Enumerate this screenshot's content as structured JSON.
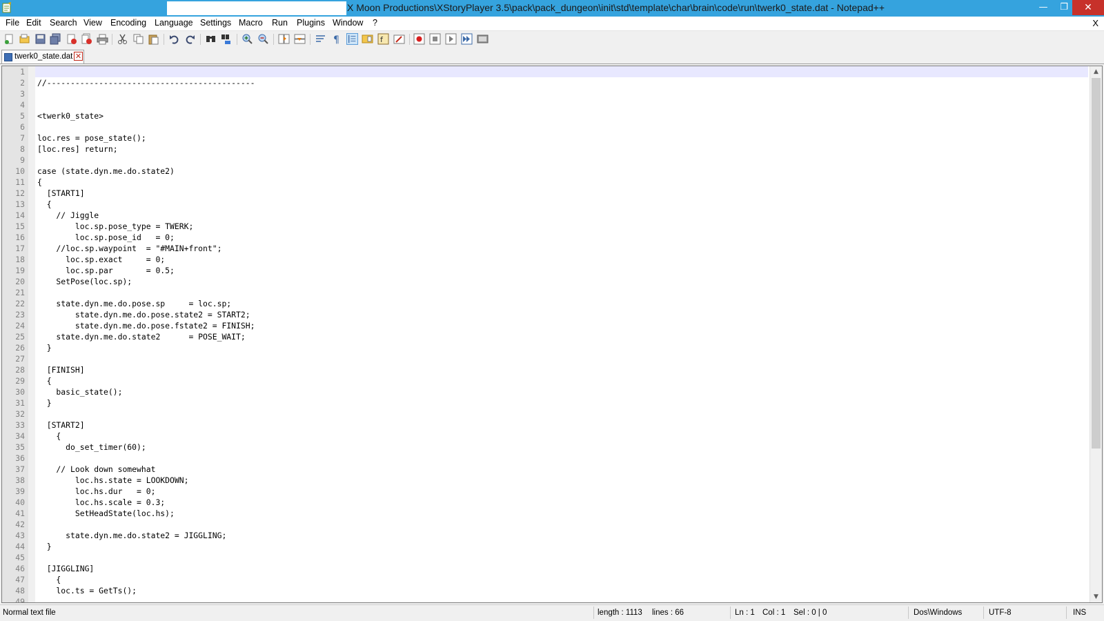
{
  "window": {
    "title": "X Moon Productions\\XStoryPlayer 3.5\\pack\\pack_dungeon\\init\\std\\template\\char\\brain\\code\\run\\twerk0_state.dat - Notepad++",
    "minimize_label": "—",
    "maximize_label": "❐",
    "close_label": "✕",
    "app_icon": "notepad-icon"
  },
  "menu": {
    "items": [
      "File",
      "Edit",
      "Search",
      "View",
      "Encoding",
      "Language",
      "Settings",
      "Macro",
      "Run",
      "Plugins",
      "Window",
      "?"
    ],
    "close_label": "X"
  },
  "toolbar": {
    "icons": [
      "new-file-icon",
      "open-file-icon",
      "save-icon",
      "save-all-icon",
      "close-icon",
      "close-all-icon",
      "print-icon",
      "cut-icon",
      "copy-icon",
      "paste-icon",
      "undo-icon",
      "redo-icon",
      "find-icon",
      "replace-icon",
      "zoom-in-icon",
      "zoom-out-icon",
      "sync-vertical-icon",
      "sync-horizontal-icon",
      "word-wrap-icon",
      "show-all-chars-icon",
      "indent-guide-icon",
      "doc-map-icon",
      "function-list-icon",
      "folder-workspace-icon",
      "record-macro-icon",
      "stop-macro-icon",
      "play-macro-icon",
      "run-macro-multiple-icon",
      "save-macro-icon"
    ]
  },
  "tab": {
    "label": "twerk0_state.dat",
    "close_label": "✕"
  },
  "editor": {
    "current_line": 1,
    "lines": [
      "",
      "//--------------------------------------------",
      "",
      "",
      "<twerk0_state>",
      "",
      "loc.res = pose_state();",
      "[loc.res] return;",
      "",
      "case (state.dyn.me.do.state2)",
      "{",
      "  [START1]",
      "  {",
      "    // Jiggle",
      "        loc.sp.pose_type = TWERK;",
      "        loc.sp.pose_id   = 0;",
      "    //loc.sp.waypoint  = \"#MAIN+front\";",
      "      loc.sp.exact     = 0;",
      "      loc.sp.par       = 0.5;",
      "    SetPose(loc.sp);",
      "",
      "    state.dyn.me.do.pose.sp     = loc.sp;",
      "        state.dyn.me.do.pose.state2 = START2;",
      "        state.dyn.me.do.pose.fstate2 = FINISH;",
      "    state.dyn.me.do.state2      = POSE_WAIT;",
      "  }",
      "",
      "  [FINISH]",
      "  {",
      "    basic_state();",
      "  }",
      "",
      "  [START2]",
      "    {",
      "      do_set_timer(60);",
      "",
      "    // Look down somewhat",
      "        loc.hs.state = LOOKDOWN;",
      "        loc.hs.dur   = 0;",
      "        loc.hs.scale = 0.3;",
      "        SetHeadState(loc.hs);",
      "",
      "      state.dyn.me.do.state2 = JIGGLING;",
      "  }",
      "",
      "  [JIGGLING]",
      "    {",
      "    loc.ts = GetTs();",
      ""
    ]
  },
  "scrollbar": {
    "up_label": "▲",
    "down_label": "▼"
  },
  "status": {
    "file_type": "Normal text file",
    "length": "length : 1113",
    "lines": "lines : 66",
    "ln": "Ln : 1",
    "col": "Col : 1",
    "sel": "Sel : 0 | 0",
    "eol": "Dos\\Windows",
    "encoding": "UTF-8",
    "mode": "INS"
  }
}
